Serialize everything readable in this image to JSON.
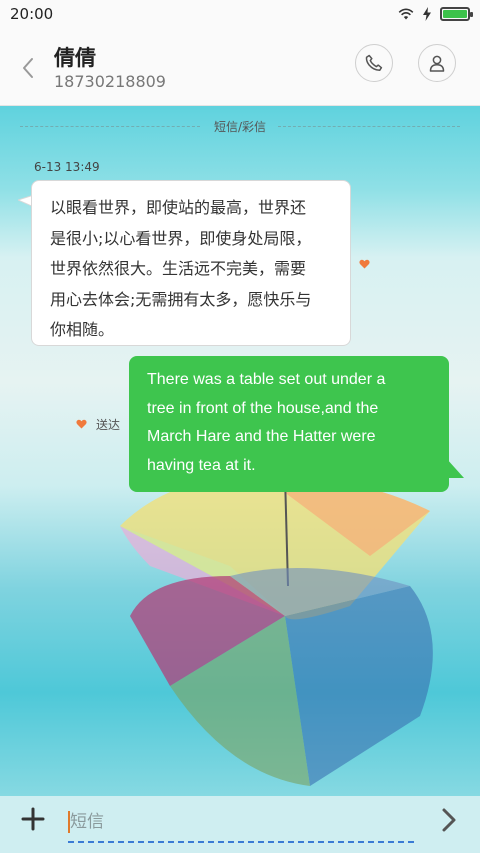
{
  "status_bar": {
    "time": "20:00",
    "battery_level": 1.0,
    "battery_color": "#3cc24a"
  },
  "header": {
    "name": "倩倩",
    "number": "18730218809"
  },
  "conversation": {
    "channel_label": "短信/彩信",
    "incoming": {
      "timestamp": "6-13 13:49",
      "lines": [
        "以眼看世界，即使站的最高，世界还",
        "是很小;以心看世界，即使身处局限，",
        "世界依然很大。生活远不完美，需要",
        "用心去体会;无需拥有太多，愿快乐与",
        "你相随。"
      ]
    },
    "outgoing": {
      "lines": [
        "There was a table set out under a",
        "tree in front of the house,and the",
        "March Hare and the Hatter were",
        "having tea at it."
      ],
      "status": "送达",
      "bubble_color": "#3ec54e"
    },
    "heart_color": "#f07a3c"
  },
  "input": {
    "placeholder": "短信",
    "value": ""
  }
}
